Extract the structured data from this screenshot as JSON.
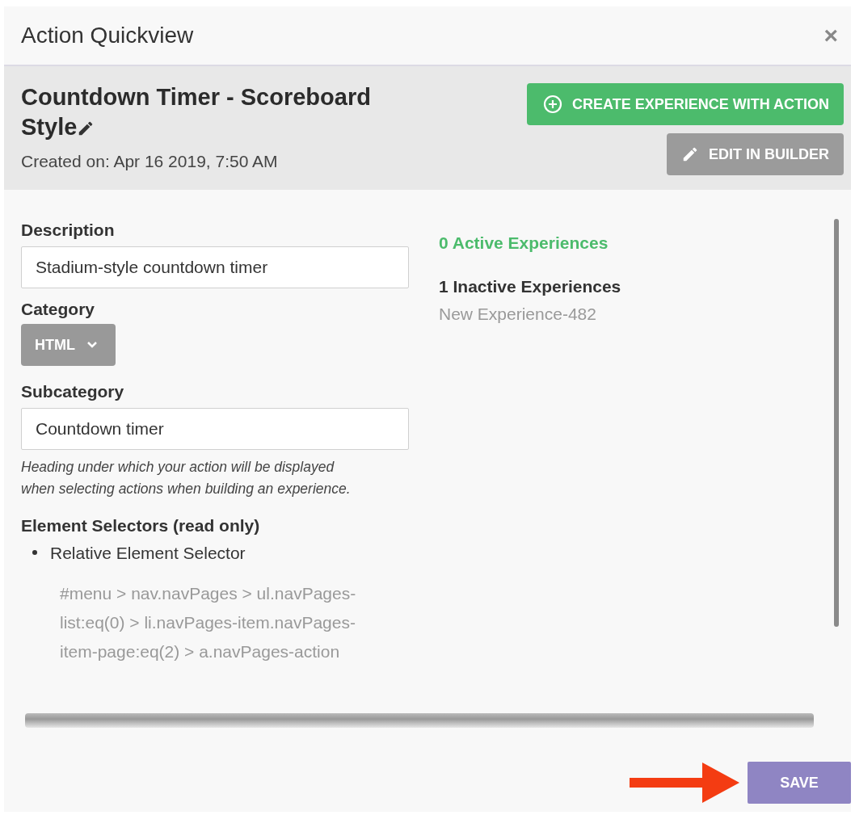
{
  "dialog": {
    "title": "Action Quickview",
    "close": "×"
  },
  "action": {
    "name": "Countdown Timer - Scoreboard Style",
    "created": "Created on: Apr 16 2019, 7:50 AM"
  },
  "buttons": [
    {
      "label": "CREATE EXPERIENCE WITH ACTION",
      "kind": "create"
    },
    {
      "label": "EDIT IN BUILDER",
      "kind": "edit"
    }
  ],
  "form": {
    "description": {
      "label": "Description",
      "value": "Stadium-style countdown timer"
    },
    "category": {
      "label": "Category",
      "value": "HTML"
    },
    "subcategory": {
      "label": "Subcategory",
      "value": "Countdown timer",
      "hint": "Heading under which your action will be displayed when selecting actions when building an experience."
    },
    "selectors": {
      "label": "Element Selectors (read only)",
      "items": [
        {
          "name": "Relative Element Selector",
          "value": "#menu > nav.navPages > ul.navPages-list:eq(0) > li.navPages-item.navPages-item-page:eq(2) > a.navPages-action"
        }
      ]
    }
  },
  "experiences": {
    "active": {
      "heading": "0 Active Experiences"
    },
    "inactive": {
      "heading": "1 Inactive Experiences",
      "items": [
        "New Experience-482"
      ]
    }
  },
  "footer": {
    "save": "SAVE"
  }
}
